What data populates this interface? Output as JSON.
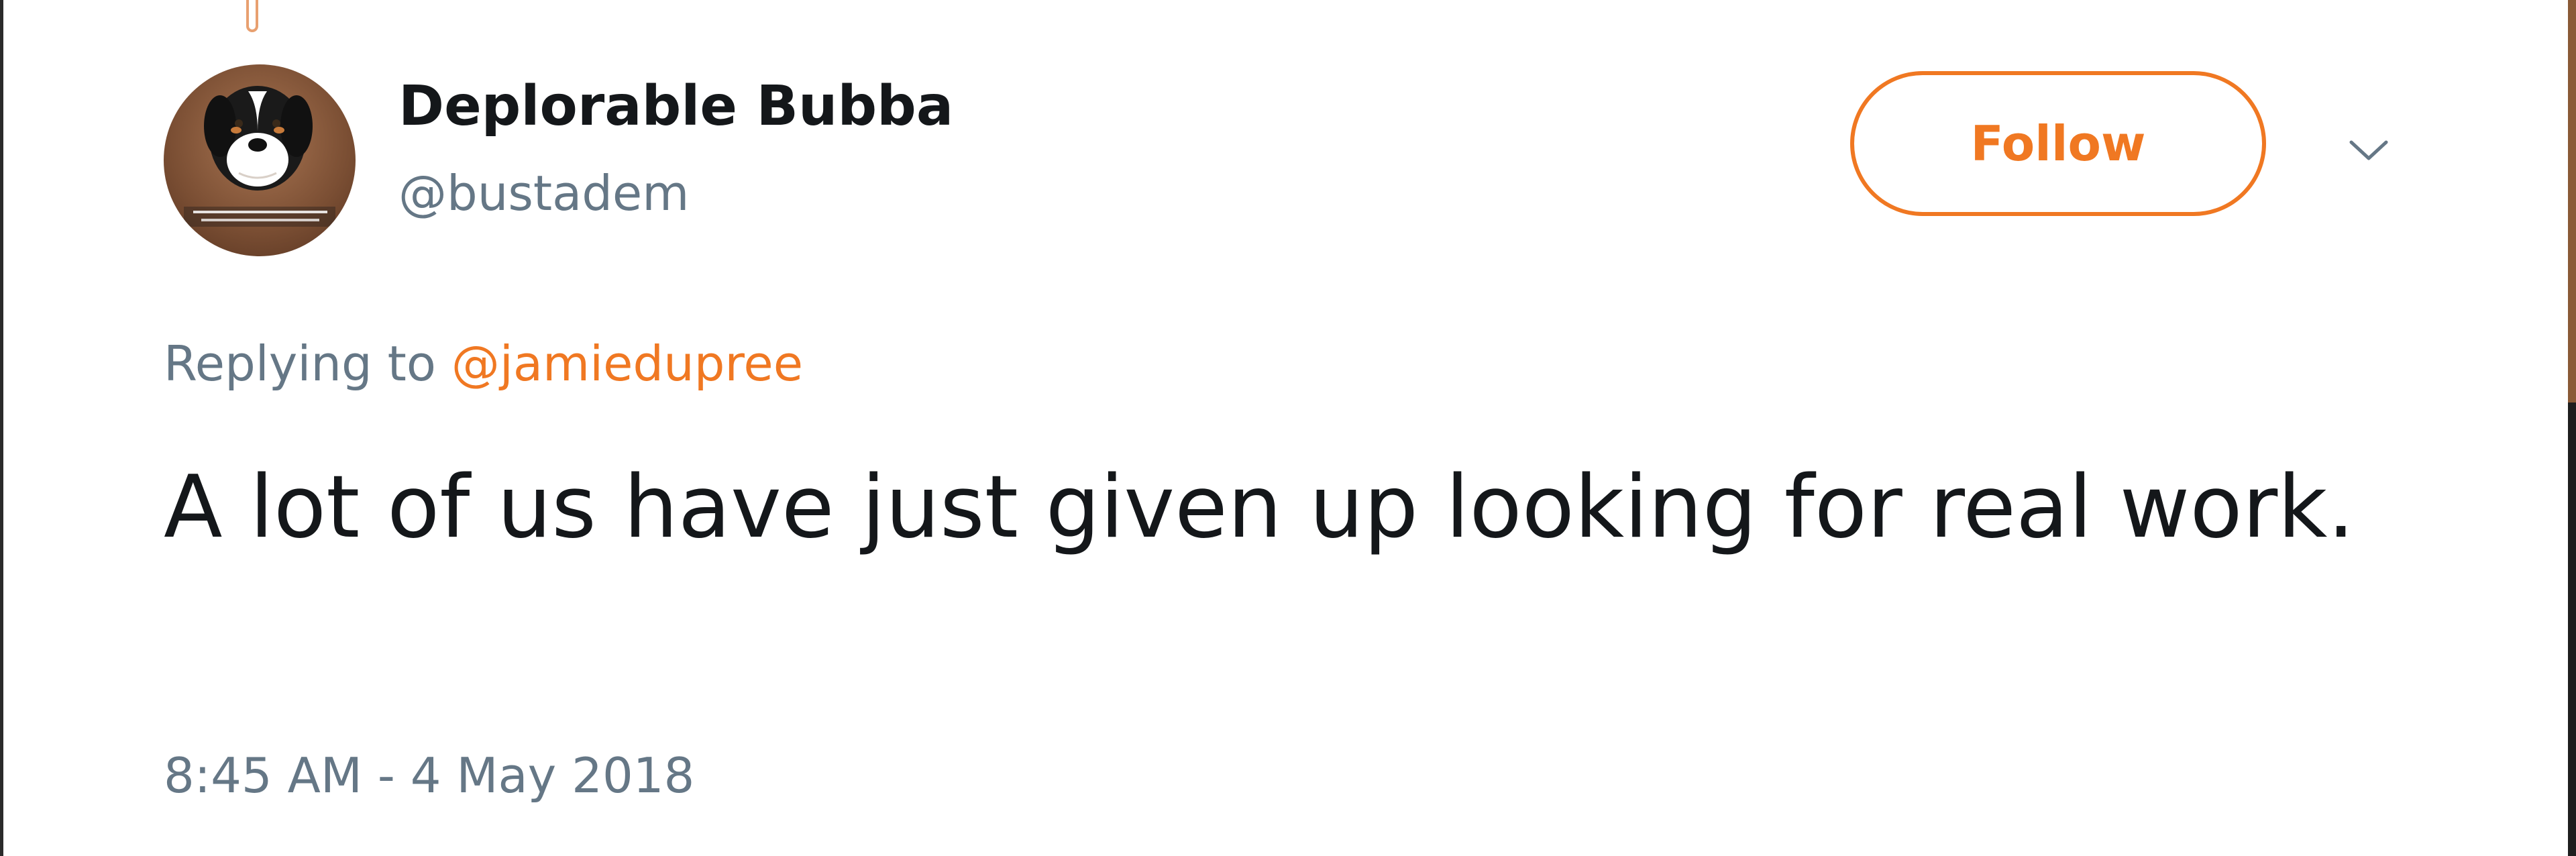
{
  "author": {
    "display_name": "Deplorable Bubba",
    "handle": "@bustadem",
    "avatar_icon": "dog-avatar"
  },
  "actions": {
    "follow_label": "Follow",
    "more_icon": "chevron-down-icon"
  },
  "reply": {
    "prefix": "Replying to ",
    "mention": "@jamiedupree"
  },
  "tweet": {
    "text": "A lot of us have just given up looking for real work.",
    "timestamp": "8:45 AM - 4 May 2018"
  },
  "colors": {
    "accent": "#f07822",
    "secondary_text": "#657786",
    "primary_text": "#14171a"
  }
}
